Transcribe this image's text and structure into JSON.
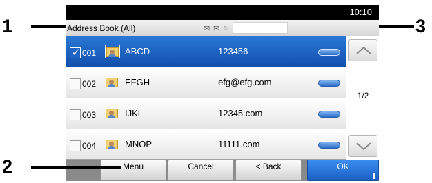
{
  "callouts": [
    "1",
    "2",
    "3"
  ],
  "status_bar": {
    "time": "10:10"
  },
  "destination_bar": {
    "address_book": "Address Book (All)",
    "type_icons": "✉ ✉ ⁙",
    "search_value": ""
  },
  "list": {
    "rows": [
      {
        "number": "001",
        "name": "ABCD",
        "detail": "123456",
        "selected": true
      },
      {
        "number": "002",
        "name": "EFGH",
        "detail": "efg@efg.com",
        "selected": false
      },
      {
        "number": "003",
        "name": "IJKL",
        "detail": "12345.com",
        "selected": false
      },
      {
        "number": "004",
        "name": "MNOP",
        "detail": "11111.com",
        "selected": false
      }
    ]
  },
  "pager": {
    "page": "1/2"
  },
  "buttons": {
    "menu": "Menu",
    "cancel": "Cancel",
    "back": "< Back",
    "ok": "OK"
  },
  "icons": [
    "checkbox-check-icon",
    "contact-card-icon",
    "destination-type-icon",
    "scroll-up-icon",
    "scroll-down-icon"
  ],
  "colors": {
    "selection": "#1f64c2",
    "ok_button": "#2b7ae0",
    "status_bar": "#000000"
  }
}
